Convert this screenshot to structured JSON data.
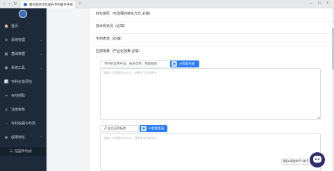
{
  "browser": {
    "tab_title": "两化融合优化提升专利服务平台",
    "close_glyph": "×",
    "new_tab_glyph": "+",
    "icons": [
      "back-icon",
      "forward-icon",
      "refresh-icon",
      "home-icon"
    ]
  },
  "sidebar": {
    "items": [
      {
        "label": "首页",
        "icon": "🏠"
      },
      {
        "label": "系统管理",
        "icon": "⚙"
      },
      {
        "label": "基础数据",
        "icon": "▦"
      },
      {
        "label": "系统工具",
        "icon": "▣"
      },
      {
        "label": "专利价值评估",
        "icon": "📊"
      },
      {
        "label": "在线抓取",
        "icon": "＋"
      },
      {
        "label": "注册审核",
        "icon": "◎"
      },
      {
        "label": "专利挖掘与布局",
        "icon": "⋯"
      },
      {
        "label": "成果转化",
        "icon": "◉"
      }
    ],
    "sub_item": {
      "label": "挖掘专利点",
      "icon": "☰"
    }
  },
  "form": {
    "rows": [
      {
        "label": "转化意愿（可选择的转化方式 必填）"
      },
      {
        "label": "技术现状况（必填）"
      },
      {
        "label": "专利表述（必填）"
      },
      {
        "label": "应用场景（产业化前景 必填）"
      }
    ],
    "section1": {
      "tab_label": "专利的应用产品、技术优势、性能指标",
      "ai_label": "AI智能生成",
      "placeholder": "请输入内容最多3000字，请参考专利说明书"
    },
    "section2": {
      "tab_label": "产业化前景描述",
      "ai_label": "AI智能生成",
      "placeholder": "请输入内容最多3000字，请参考专利说明书"
    }
  },
  "assistant": {
    "tip": "我是AI智能助手小助手"
  }
}
